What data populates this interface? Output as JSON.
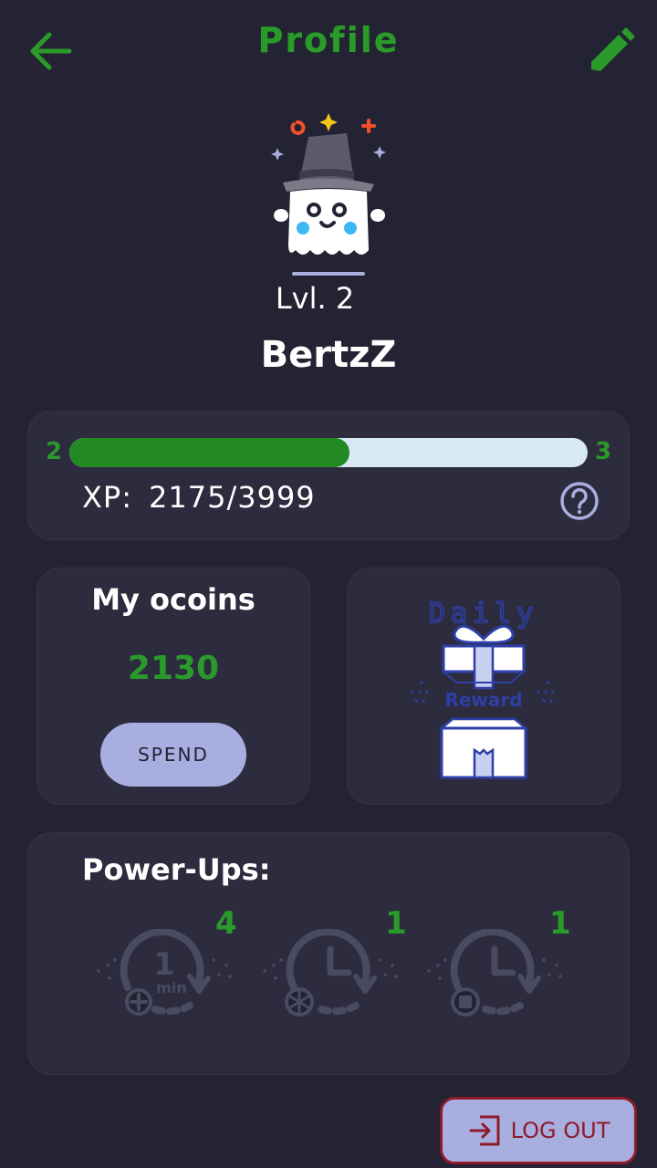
{
  "header": {
    "title": "Profile",
    "back_icon": "arrow-left-icon",
    "edit_icon": "pencil-icon"
  },
  "profile": {
    "level_text": "Lvl. 2",
    "username": "BertzZ"
  },
  "xp": {
    "current_level": "2",
    "next_level": "3",
    "label": "XP:",
    "value_text": "2175/3999",
    "progress_fraction": 0.54
  },
  "coins": {
    "title": "My ocoins",
    "value": "2130",
    "spend_label": "SPEND"
  },
  "daily_reward": {
    "top_text": "Daily",
    "ribbon_text": "Reward"
  },
  "powerups": {
    "title": "Power-Ups:",
    "items": [
      {
        "count": "4",
        "icon": "add-one-minute-icon",
        "icon_text": "1",
        "icon_sub": "min"
      },
      {
        "count": "1",
        "icon": "freeze-time-icon"
      },
      {
        "count": "1",
        "icon": "stop-time-icon"
      }
    ]
  },
  "logout": {
    "label": "LOG OUT",
    "icon": "logout-icon"
  },
  "colors": {
    "background": "#232333",
    "card": "#2c2c3e",
    "accent_green": "#2a9a2a",
    "button_lavender": "#a9aee0",
    "logout_red": "#8e1b2a"
  }
}
